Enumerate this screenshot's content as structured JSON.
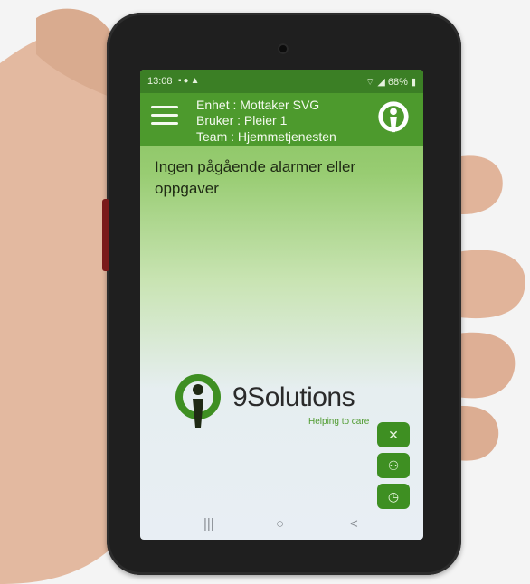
{
  "status_bar": {
    "time": "13:08",
    "battery": "68%"
  },
  "app_header": {
    "device": "Enhet : Mottaker SVG",
    "user": "Bruker : Pleier 1",
    "team": "Team : Hjemmetjenesten"
  },
  "message": "Ingen pågående alarmer eller oppgaver",
  "brand": {
    "name": "9Solutions",
    "tagline": "Helping to care"
  },
  "colors": {
    "header_green": "#4d9a2d",
    "status_green": "#3b7f25",
    "fab_green": "#3e8f22"
  }
}
